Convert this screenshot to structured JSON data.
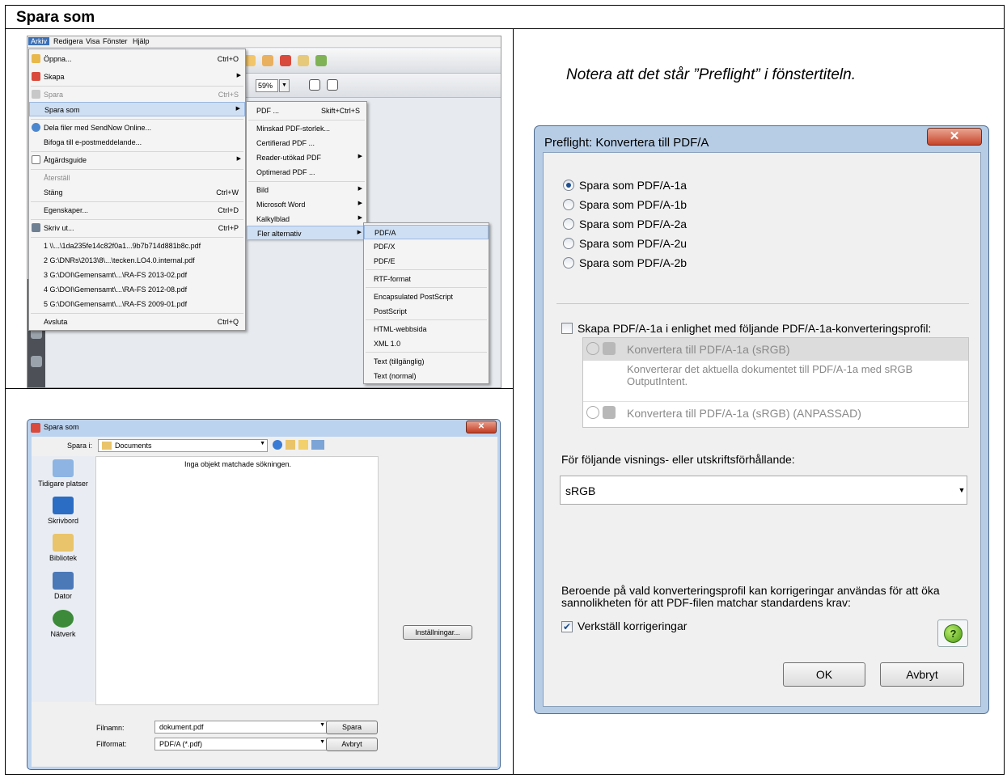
{
  "doc": {
    "title": "Spara som",
    "note": "Notera att det står ”Preflight” i fönstertiteln."
  },
  "app": {
    "menubar": [
      "Arkiv",
      "Redigera",
      "Visa",
      "Fönster",
      "Hjälp"
    ],
    "zoom": "59%",
    "arkiv_menu": [
      {
        "label": "Öppna...",
        "shortcut": "Ctrl+O"
      },
      {
        "label": "Skapa",
        "shortcut": ""
      },
      {
        "label": "Spara",
        "shortcut": "Ctrl+S"
      },
      {
        "label": "Spara som",
        "shortcut": ""
      },
      {
        "label": "Dela filer med SendNow Online...",
        "shortcut": ""
      },
      {
        "label": "Bifoga till e-postmeddelande...",
        "shortcut": ""
      },
      {
        "label": "Åtgärdsguide",
        "shortcut": ""
      },
      {
        "label": "Återställ",
        "shortcut": ""
      },
      {
        "label": "Stäng",
        "shortcut": "Ctrl+W"
      },
      {
        "label": "Egenskaper...",
        "shortcut": "Ctrl+D"
      },
      {
        "label": "Skriv ut...",
        "shortcut": "Ctrl+P"
      },
      {
        "label": "1 \\\\...\\1da235fe14c82f0a1...9b7b714d881b8c.pdf",
        "shortcut": ""
      },
      {
        "label": "2 G:\\DNRs\\2013\\8\\...\\tecken.LO4.0.internal.pdf",
        "shortcut": ""
      },
      {
        "label": "3 G:\\DOI\\Gemensamt\\...\\RA-FS 2013-02.pdf",
        "shortcut": ""
      },
      {
        "label": "4 G:\\DOI\\Gemensamt\\...\\RA-FS 2012-08.pdf",
        "shortcut": ""
      },
      {
        "label": "5 G:\\DOI\\Gemensamt\\...\\RA-FS 2009-01.pdf",
        "shortcut": ""
      },
      {
        "label": "Avsluta",
        "shortcut": "Ctrl+Q"
      }
    ],
    "spara_som_menu": [
      {
        "label": "PDF ...",
        "shortcut": "Skift+Ctrl+S"
      },
      {
        "label": "Minskad PDF-storlek...",
        "shortcut": ""
      },
      {
        "label": "Certifierad PDF ...",
        "shortcut": ""
      },
      {
        "label": "Reader-utökad PDF",
        "shortcut": ""
      },
      {
        "label": "Optimerad PDF ...",
        "shortcut": ""
      },
      {
        "label": "Bild",
        "shortcut": ""
      },
      {
        "label": "Microsoft Word",
        "shortcut": ""
      },
      {
        "label": "Kalkylblad",
        "shortcut": ""
      },
      {
        "label": "Fler alternativ",
        "shortcut": ""
      }
    ],
    "fler_menu": [
      "PDF/A",
      "PDF/X",
      "PDF/E",
      "RTF-format",
      "Encapsulated PostScript",
      "PostScript",
      "HTML-webbsida",
      "XML 1.0",
      "Text (tillgänglig)",
      "Text (normal)"
    ]
  },
  "save_dialog": {
    "title": "Spara som",
    "save_in_label": "Spara i:",
    "save_in_value": "Documents",
    "places": [
      "Tidigare platser",
      "Skrivbord",
      "Bibliotek",
      "Dator",
      "Nätverk"
    ],
    "empty_message": "Inga objekt matchade sökningen.",
    "settings_button": "Inställningar...",
    "filename_label": "Filnamn:",
    "filename_value": "dokument.pdf",
    "format_label": "Filformat:",
    "format_value": "PDF/A (*.pdf)",
    "save_button": "Spara",
    "cancel_button": "Avbryt"
  },
  "preflight_dialog": {
    "title": "Preflight: Konvertera till PDF/A",
    "options": [
      "Spara som PDF/A-1a",
      "Spara som PDF/A-1b",
      "Spara som PDF/A-2a",
      "Spara som PDF/A-2u",
      "Spara som PDF/A-2b"
    ],
    "selected_option": "Spara som PDF/A-1a",
    "profile_checkbox": "Skapa PDF/A-1a i enlighet med följande PDF/A-1a-konverteringsprofil:",
    "profile1": "Konvertera till PDF/A-1a (sRGB)",
    "profile1_desc": "Konverterar det aktuella dokumentet till PDF/A-1a med sRGB OutputIntent.",
    "profile2": "Konvertera till PDF/A-1a (sRGB) (ANPASSAD)",
    "condition_label": "För följande visnings- eller utskriftsförhållande:",
    "condition_value": "sRGB",
    "info_text": "Beroende på vald konverteringsprofil kan korrigeringar användas för att öka sannolikheten för att PDF-filen matchar standardens krav:",
    "fix_checkbox": "Verkställ korrigeringar",
    "fix_checked": true,
    "help": "?",
    "ok_button": "OK",
    "cancel_button": "Avbryt"
  }
}
